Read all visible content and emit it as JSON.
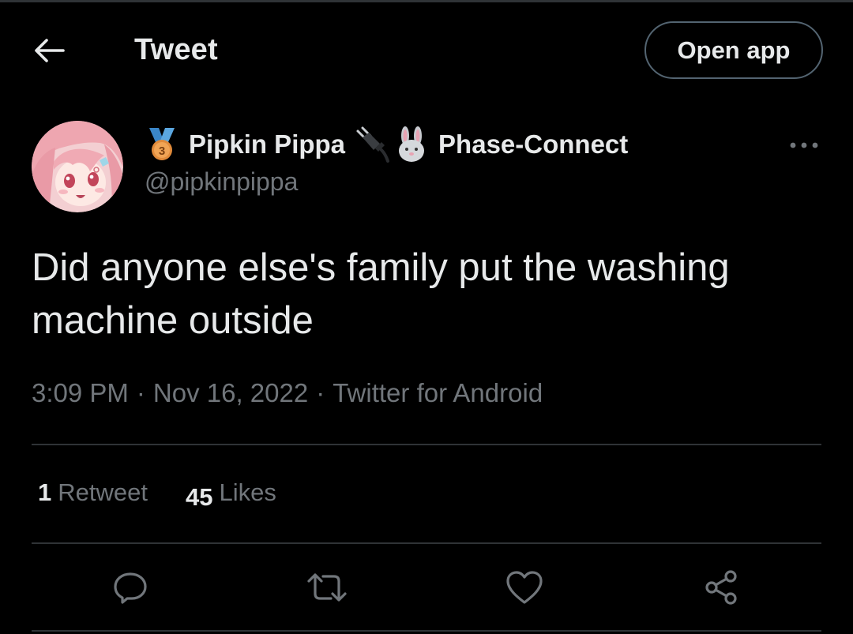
{
  "header": {
    "title": "Tweet",
    "back_icon": "arrow-left-icon",
    "open_app_label": "Open app"
  },
  "author": {
    "display_name": "Pipkin Pippa",
    "handle": "@pipkinpippa",
    "affiliation": "Phase-Connect",
    "medal_number": "3",
    "name_emojis": [
      "medal-icon",
      "plug-icon",
      "rabbit-icon"
    ],
    "more_icon": "more-dots-icon"
  },
  "tweet": {
    "text": "Did anyone else's family put the washing machine outside",
    "time": "3:09 PM",
    "separator": "·",
    "date": "Nov 16, 2022",
    "source": "Twitter for Android"
  },
  "stats": {
    "retweets_count": "1",
    "retweets_label": "Retweet",
    "likes_count": "45",
    "likes_label": "Likes"
  },
  "actions": [
    "reply-icon",
    "retweet-icon",
    "like-icon",
    "share-icon"
  ],
  "colors": {
    "background": "#000000",
    "text_primary": "#e7e9ea",
    "text_secondary": "#71767b",
    "divider": "#2f3336",
    "button_border": "#536471"
  }
}
